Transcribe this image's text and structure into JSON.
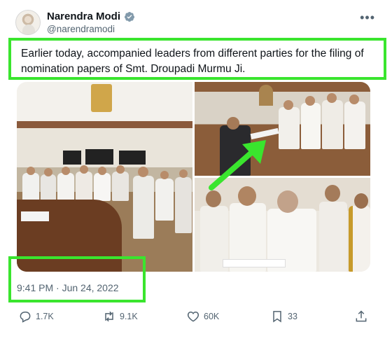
{
  "author": {
    "display_name": "Narendra Modi",
    "handle": "@narendramodi",
    "verified": true
  },
  "tweet": {
    "text": "Earlier today, accompanied leaders from different parties for the filing of nomination papers of Smt. Droupadi Murmu Ji.",
    "timestamp": "9:41 PM · Jun 24, 2022"
  },
  "actions": {
    "replies": "1.7K",
    "reposts": "9.1K",
    "likes": "60K",
    "bookmarks": "33"
  },
  "highlight_color": "#3ae52e",
  "icons": [
    "verified-badge-icon",
    "more-icon",
    "reply-icon",
    "repost-icon",
    "like-icon",
    "bookmark-icon",
    "share-icon"
  ]
}
